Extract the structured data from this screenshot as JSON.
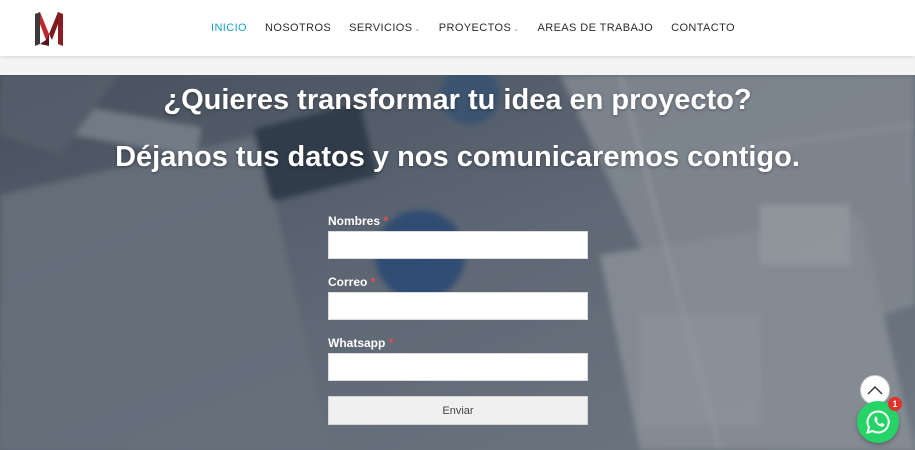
{
  "brand": {
    "logo_icon": "m-monogram-logo",
    "colors": {
      "dark_red": "#7a1a1f",
      "red": "#c0262d",
      "charcoal": "#3a3a3a"
    }
  },
  "nav": {
    "items": [
      {
        "label": "INICIO",
        "active": true,
        "has_dropdown": false
      },
      {
        "label": "NOSOTROS",
        "active": false,
        "has_dropdown": false
      },
      {
        "label": "SERVICIOS",
        "active": false,
        "has_dropdown": true
      },
      {
        "label": "PROYECTOS",
        "active": false,
        "has_dropdown": true
      },
      {
        "label": "AREAS DE TRABAJO",
        "active": false,
        "has_dropdown": false
      },
      {
        "label": "CONTACTO",
        "active": false,
        "has_dropdown": false
      }
    ],
    "active_color": "#1aa3c4"
  },
  "hero": {
    "title": "¿Quieres transformar tu idea en proyecto?",
    "subtitle": "Déjanos tus datos y nos comunicaremos contigo."
  },
  "form": {
    "fields": [
      {
        "label": "Nombres",
        "required_mark": "*",
        "value": ""
      },
      {
        "label": "Correo",
        "required_mark": "*",
        "value": ""
      },
      {
        "label": "Whatsapp",
        "required_mark": "*",
        "value": ""
      }
    ],
    "submit_label": "Enviar"
  },
  "floating": {
    "scroll_top_icon": "chevron-up-icon",
    "whatsapp_icon": "whatsapp-icon",
    "whatsapp_badge": "1",
    "whatsapp_color": "#25d366"
  }
}
